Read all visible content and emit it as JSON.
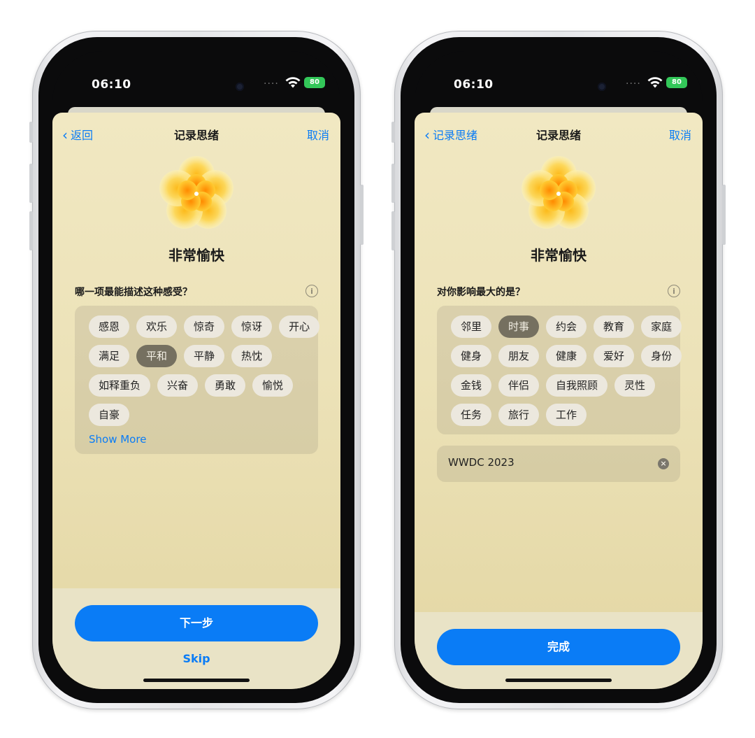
{
  "colors": {
    "accent": "#0a7cf6",
    "selected_chip": "#757060",
    "sheet": "#ece2b8",
    "battery": "#33c759"
  },
  "status": {
    "time": "06:10",
    "dots": "....",
    "battery": "80"
  },
  "left": {
    "nav": {
      "back_label": "返回",
      "title": "记录思绪",
      "cancel_label": "取消"
    },
    "mood": "非常愉快",
    "question": "哪一项最能描述这种感受？",
    "chips": [
      [
        "感恩",
        "欢乐",
        "惊奇",
        "惊讶",
        "开心"
      ],
      [
        "满足",
        "平和",
        "平静",
        "热忱"
      ],
      [
        "如释重负",
        "兴奋",
        "勇敢",
        "愉悦"
      ],
      [
        "自豪"
      ]
    ],
    "selected": "平和",
    "show_more": "Show More",
    "primary_label": "下一步",
    "skip_label": "Skip"
  },
  "right": {
    "nav": {
      "back_label": "记录思绪",
      "title": "记录思绪",
      "cancel_label": "取消"
    },
    "mood": "非常愉快",
    "question": "对你影响最大的是？",
    "chips": [
      [
        "邻里",
        "时事",
        "约会",
        "教育",
        "家庭"
      ],
      [
        "健身",
        "朋友",
        "健康",
        "爱好",
        "身份"
      ],
      [
        "金钱",
        "伴侣",
        "自我照顾",
        "灵性"
      ],
      [
        "任务",
        "旅行",
        "工作"
      ]
    ],
    "selected": "时事",
    "input_value": "WWDC 2023",
    "primary_label": "完成"
  }
}
